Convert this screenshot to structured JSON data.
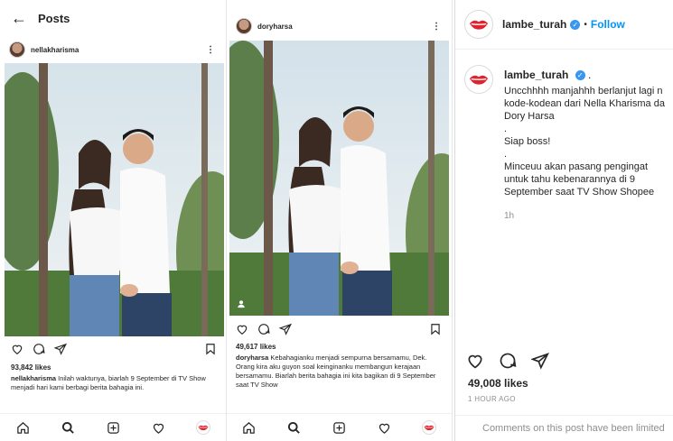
{
  "left_panel": {
    "title": "Posts",
    "username": "nellakharisma",
    "likes": "93,842 likes",
    "caption_user": "nellakharisma",
    "caption_text": "Inilah waktunya, biarlah 9 September di TV Show        menjadi hari kami berbagi berita bahagia ini."
  },
  "middle_panel": {
    "username": "doryharsa",
    "likes": "49,617 likes",
    "caption_user": "doryharsa",
    "caption_text": "Kebahagianku menjadi sempurna bersamamu, Dek. Orang kira aku guyon soal keinginanku membangun kerajaan bersamamu. Biarlah berita bahagia ini kita bagikan di 9 September saat TV Show"
  },
  "right_panel": {
    "username": "lambe_turah",
    "follow": "Follow",
    "dot": "•",
    "comment_username": "lambe_turah",
    "comment_dot": ".",
    "comment_text": "Uncchhhh manjahhh berlanjut lagi n\nkode-kodean dari Nella Kharisma da\nDory Harsa\n.\nSiap boss!\n.\nMinceuu akan pasang pengingat\nuntuk tahu kebenarannya di 9\nSeptember saat TV Show Shopee",
    "comment_time": "1h",
    "likes": "49,008 likes",
    "date": "1 HOUR AGO",
    "comments_notice": "Comments on this post have been limited"
  },
  "icons": [
    "back-arrow-icon",
    "more-icon",
    "heart-icon",
    "comment-icon",
    "share-icon",
    "bookmark-icon",
    "home-icon",
    "search-icon",
    "add-icon",
    "activity-icon",
    "profile-icon",
    "verified-icon",
    "tag-user-icon"
  ],
  "colors": {
    "accent": "#0095f6",
    "verified": "#3897f0",
    "lips": "#e0242f"
  }
}
